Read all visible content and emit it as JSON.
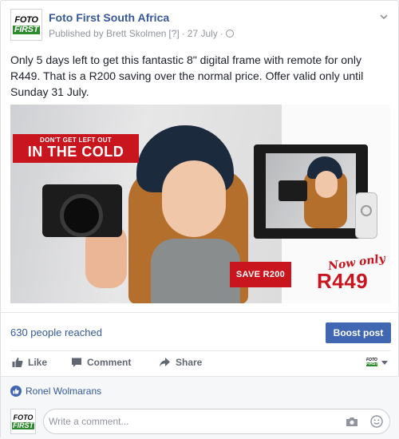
{
  "post": {
    "page_name": "Foto First South Africa",
    "logo_line1": "FOTO",
    "logo_line2": "FIRST",
    "published_by": "Published by Brett Skolmen",
    "edited_marker": "[?]",
    "separator": "·",
    "date": "27 July",
    "separator2": "·",
    "text": "Only 5 days left to get this fantastic 8\" digital frame with remote for only R449. That is a R200 saving over the normal price. Offer valid only until Sunday 31 July."
  },
  "ad": {
    "banner_small": "DON'T GET LEFT OUT",
    "banner_big": "IN THE COLD",
    "save_label": "SAVE R200",
    "now_only": "Now only",
    "price": "R449"
  },
  "reach": {
    "reached_text": "630 people reached",
    "boost_label": "Boost post"
  },
  "actions": {
    "like": "Like",
    "comment": "Comment",
    "share": "Share",
    "mini_logo_1": "FOTO",
    "mini_logo_2": "FIRST"
  },
  "comments": {
    "reactor_name": "Ronel Wolmarans",
    "placeholder": "Write a comment..."
  },
  "colors": {
    "link_blue": "#365899",
    "brand_green": "#2e8b2e",
    "ad_red": "#c9151e",
    "boost_blue": "#4267b2"
  }
}
